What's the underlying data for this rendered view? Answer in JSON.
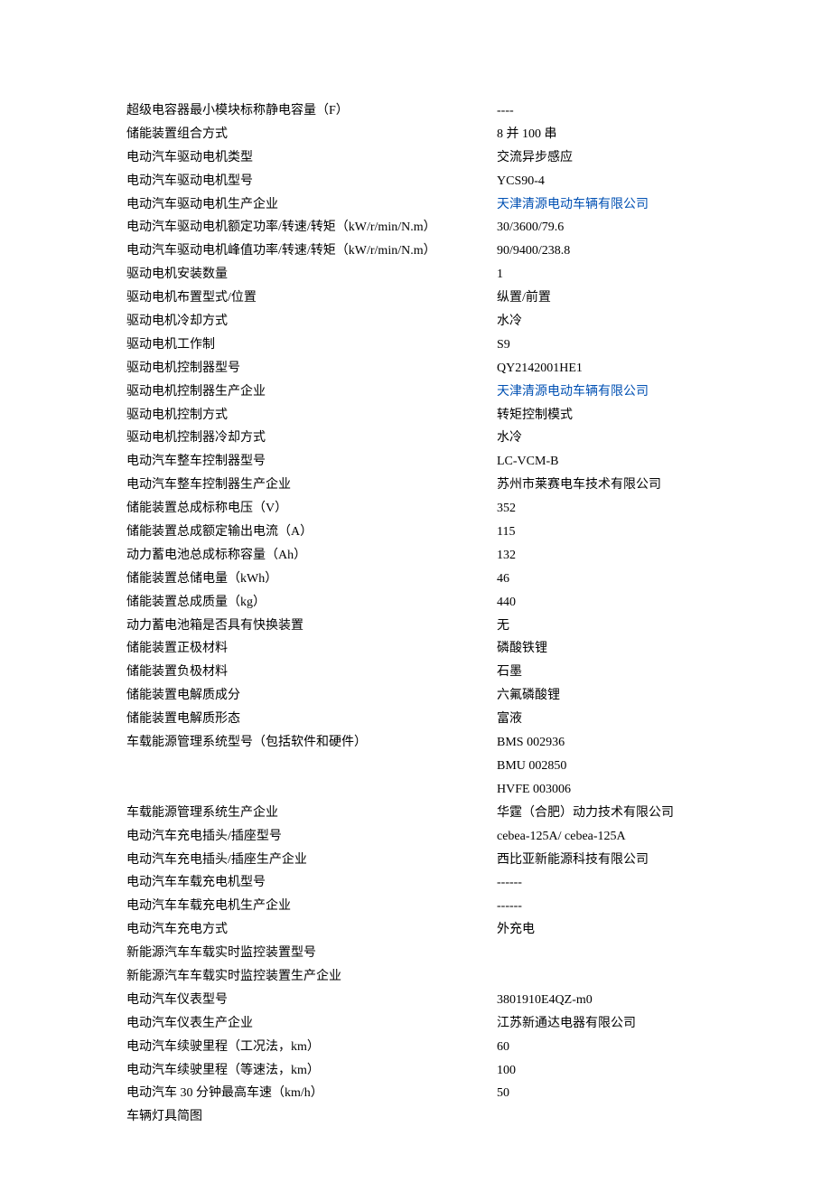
{
  "rows": [
    {
      "label": "超级电容器最小模块标称静电容量（F）",
      "value": "----",
      "link": false
    },
    {
      "label": "储能装置组合方式",
      "value": "8 并 100 串",
      "link": false
    },
    {
      "label": "电动汽车驱动电机类型",
      "value": "交流异步感应",
      "link": false
    },
    {
      "label": "电动汽车驱动电机型号",
      "value": "YCS90-4",
      "link": false
    },
    {
      "label": "电动汽车驱动电机生产企业",
      "value": "天津清源电动车辆有限公司",
      "link": true
    },
    {
      "label": "电动汽车驱动电机额定功率/转速/转矩（kW/r/min/N.m）",
      "value": "30/3600/79.6",
      "link": false
    },
    {
      "label": "电动汽车驱动电机峰值功率/转速/转矩（kW/r/min/N.m）",
      "value": "90/9400/238.8",
      "link": false
    },
    {
      "label": "驱动电机安装数量",
      "value": "1",
      "link": false
    },
    {
      "label": "驱动电机布置型式/位置",
      "value": "纵置/前置",
      "link": false
    },
    {
      "label": "驱动电机冷却方式",
      "value": "水冷",
      "link": false
    },
    {
      "label": "驱动电机工作制",
      "value": "S9",
      "link": false
    },
    {
      "label": "驱动电机控制器型号",
      "value": "QY2142001HE1",
      "link": false
    },
    {
      "label": "驱动电机控制器生产企业",
      "value": "天津清源电动车辆有限公司",
      "link": true
    },
    {
      "label": "驱动电机控制方式",
      "value": "转矩控制模式",
      "link": false
    },
    {
      "label": "驱动电机控制器冷却方式",
      "value": "水冷",
      "link": false
    },
    {
      "label": "电动汽车整车控制器型号",
      "value": "LC-VCM-B",
      "link": false
    },
    {
      "label": "电动汽车整车控制器生产企业",
      "value": "苏州市莱赛电车技术有限公司",
      "link": false
    },
    {
      "label": "储能装置总成标称电压（V）",
      "value": "352",
      "link": false
    },
    {
      "label": "储能装置总成额定输出电流（A）",
      "value": "115",
      "link": false
    },
    {
      "label": "动力蓄电池总成标称容量（Ah）",
      "value": "132",
      "link": false
    },
    {
      "label": "储能装置总储电量（kWh）",
      "value": "46",
      "link": false
    },
    {
      "label": "储能装置总成质量（kg）",
      "value": "440",
      "link": false
    },
    {
      "label": "动力蓄电池箱是否具有快换装置",
      "value": "无",
      "link": false
    },
    {
      "label": "储能装置正极材料",
      "value": "磷酸铁锂",
      "link": false
    },
    {
      "label": "储能装置负极材料",
      "value": "石墨",
      "link": false
    },
    {
      "label": "储能装置电解质成分",
      "value": "六氟磷酸锂",
      "link": false
    },
    {
      "label": "储能装置电解质形态",
      "value": "富液",
      "link": false
    },
    {
      "label": "车载能源管理系统型号（包括软件和硬件）",
      "value": "BMS   002936",
      "link": false,
      "extra": [
        "BMU   002850",
        "HVFE   003006"
      ]
    },
    {
      "label": "车载能源管理系统生产企业",
      "value": "华霆（合肥）动力技术有限公司",
      "link": false
    },
    {
      "label": "电动汽车充电插头/插座型号",
      "value": "cebea-125A/ cebea-125A",
      "link": false
    },
    {
      "label": "电动汽车充电插头/插座生产企业",
      "value": "西比亚新能源科技有限公司",
      "link": false
    },
    {
      "label": "电动汽车车载充电机型号",
      "value": "------",
      "link": false
    },
    {
      "label": "电动汽车车载充电机生产企业",
      "value": "------",
      "link": false
    },
    {
      "label": "电动汽车充电方式",
      "value": "外充电",
      "link": false
    },
    {
      "label": "新能源汽车车载实时监控装置型号",
      "value": "",
      "link": false
    },
    {
      "label": "新能源汽车车载实时监控装置生产企业",
      "value": "",
      "link": false
    },
    {
      "label": "电动汽车仪表型号",
      "value": "3801910E4QZ-m0",
      "link": false
    },
    {
      "label": "电动汽车仪表生产企业",
      "value": "江苏新通达电器有限公司",
      "link": false
    },
    {
      "label": "电动汽车续驶里程（工况法，km）",
      "value": "60",
      "link": false
    },
    {
      "label": "电动汽车续驶里程（等速法，km）",
      "value": "100",
      "link": false
    },
    {
      "label": "电动汽车 30 分钟最高车速（km/h）",
      "value": "50",
      "link": false
    },
    {
      "label": "车辆灯具简图",
      "value": "",
      "link": false
    }
  ]
}
